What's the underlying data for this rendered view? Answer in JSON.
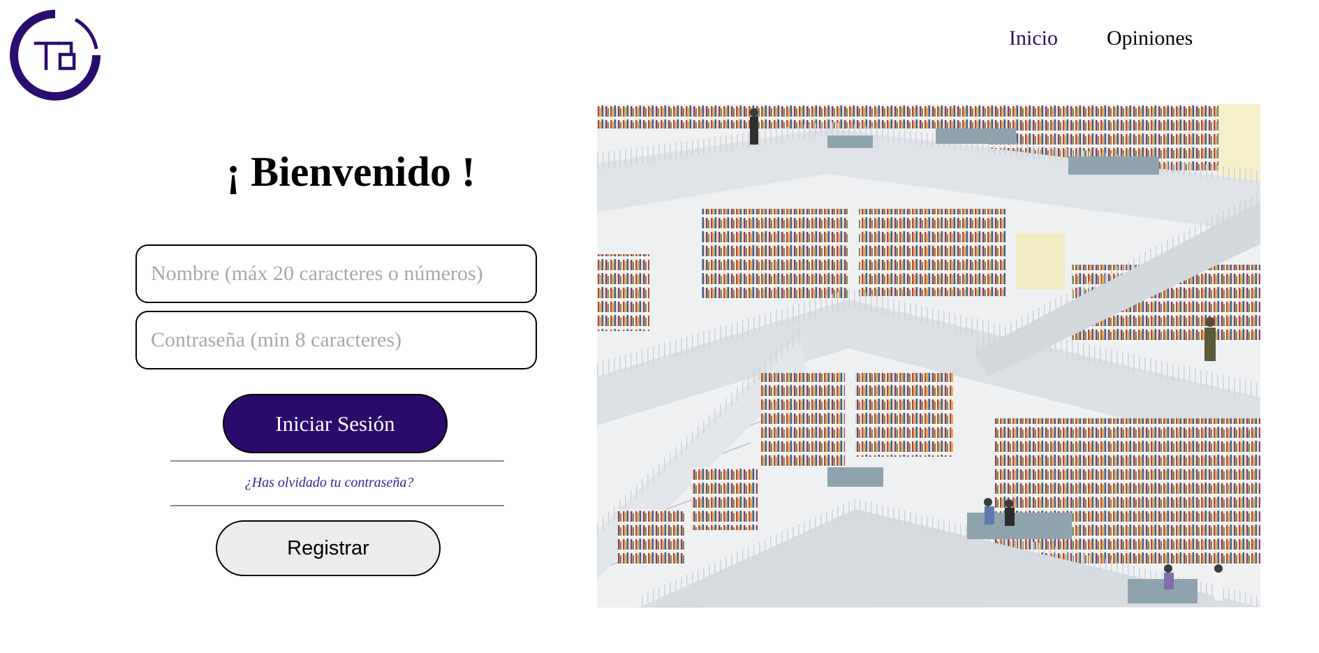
{
  "logo": {
    "text": "TB",
    "color": "#2a0d6e"
  },
  "nav": {
    "items": [
      {
        "label": "Inicio",
        "active": true
      },
      {
        "label": "Opiniones",
        "active": false
      }
    ]
  },
  "login": {
    "title": "¡ Bienvenido !",
    "name_placeholder": "Nombre (máx 20 caracteres o números)",
    "password_placeholder": "Contraseña (min 8 caracteres)",
    "submit_label": "Iniciar Sesión",
    "forgot_label": "¿Has olvidado tu contraseña?",
    "register_label": "Registrar"
  },
  "colors": {
    "brand": "#2a0d6e",
    "button_primary": "#2a0a6b",
    "link": "#3b1ea0",
    "button_secondary": "#ececec"
  },
  "hero": {
    "icon": "library-interior-image"
  }
}
